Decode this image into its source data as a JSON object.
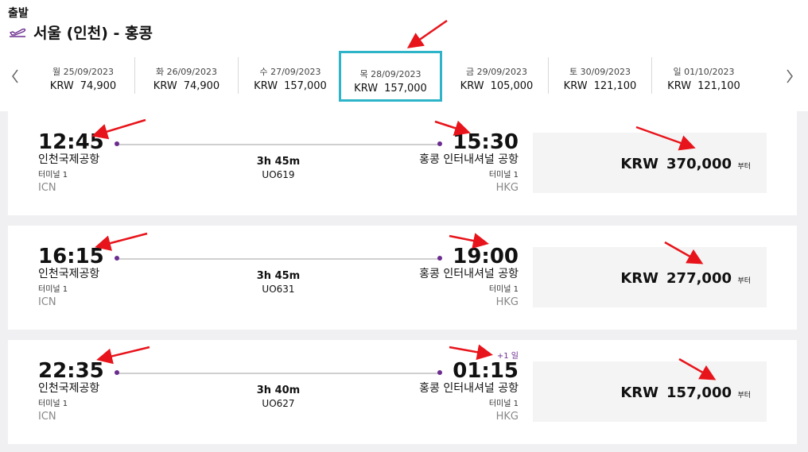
{
  "header": {
    "departure_label": "출발",
    "route": "서울 (인천) - 홍콩"
  },
  "dates": [
    {
      "date": "월 25/09/2023",
      "currency": "KRW",
      "price": "74,900"
    },
    {
      "date": "화 26/09/2023",
      "currency": "KRW",
      "price": "74,900"
    },
    {
      "date": "수 27/09/2023",
      "currency": "KRW",
      "price": "157,000"
    },
    {
      "date": "목 28/09/2023",
      "currency": "KRW",
      "price": "157,000",
      "selected": true
    },
    {
      "date": "금 29/09/2023",
      "currency": "KRW",
      "price": "105,000"
    },
    {
      "date": "토 30/09/2023",
      "currency": "KRW",
      "price": "121,100"
    },
    {
      "date": "일 01/10/2023",
      "currency": "KRW",
      "price": "121,100"
    }
  ],
  "flights": [
    {
      "dep_time": "12:45",
      "dep_airport": "인천국제공항",
      "dep_terminal": "터미널 1",
      "dep_code": "ICN",
      "arr_time": "15:30",
      "arr_airport": "홍콩 인터내셔널 공항",
      "arr_terminal": "터미널 1",
      "arr_code": "HKG",
      "duration": "3h 45m",
      "flight_no": "UO619",
      "plus_day": "",
      "currency": "KRW",
      "price": "370,000",
      "from_label": "부터"
    },
    {
      "dep_time": "16:15",
      "dep_airport": "인천국제공항",
      "dep_terminal": "터미널 1",
      "dep_code": "ICN",
      "arr_time": "19:00",
      "arr_airport": "홍콩 인터내셔널 공항",
      "arr_terminal": "터미널 1",
      "arr_code": "HKG",
      "duration": "3h 45m",
      "flight_no": "UO631",
      "plus_day": "",
      "currency": "KRW",
      "price": "277,000",
      "from_label": "부터"
    },
    {
      "dep_time": "22:35",
      "dep_airport": "인천국제공항",
      "dep_terminal": "터미널 1",
      "dep_code": "ICN",
      "arr_time": "01:15",
      "arr_airport": "홍콩 인터내셔널 공항",
      "arr_terminal": "터미널 1",
      "arr_code": "HKG",
      "duration": "3h 40m",
      "flight_no": "UO627",
      "plus_day": "+1 일",
      "currency": "KRW",
      "price": "157,000",
      "from_label": "부터"
    }
  ],
  "colors": {
    "accent_purple": "#6b2c8f",
    "selected_border": "#2db4c9",
    "annotation_arrow": "#e8141b"
  },
  "icons": {
    "route": "plane-takeoff-icon",
    "prev": "chevron-left-icon",
    "next": "chevron-right-icon"
  }
}
